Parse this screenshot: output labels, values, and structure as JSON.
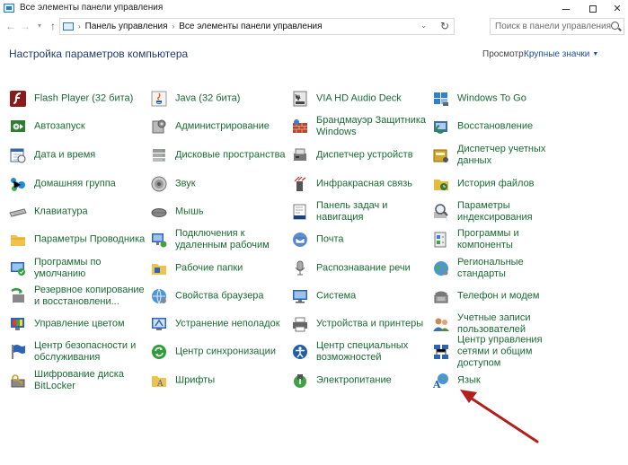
{
  "window": {
    "title": "Все элементы панели управления",
    "controls": {
      "minimize": "—",
      "maximize": "☐",
      "close": "✕"
    }
  },
  "address": {
    "crumbs": [
      "Панель управления",
      "Все элементы панели управления"
    ],
    "search_placeholder": "Поиск в панели управления"
  },
  "header": {
    "title": "Настройка параметров компьютера",
    "view_label": "Просмотр:",
    "view_value": "Крупные значки"
  },
  "colors": {
    "link": "#1a6a34",
    "heading": "#1e3c78",
    "arrow": "#b11f1f"
  },
  "items": [
    {
      "label": "Flash Player (32 бита)",
      "icon": "flash-icon"
    },
    {
      "label": "Java (32 бита)",
      "icon": "java-icon"
    },
    {
      "label": "VIA HD Audio Deck",
      "icon": "audio-deck-icon"
    },
    {
      "label": "Windows To Go",
      "icon": "windows-to-go-icon"
    },
    {
      "label": "Автозапуск",
      "icon": "autoplay-icon"
    },
    {
      "label": "Администрирование",
      "icon": "admin-tools-icon"
    },
    {
      "label": "Брандмауэр Защитника Windows",
      "icon": "firewall-icon"
    },
    {
      "label": "Восстановление",
      "icon": "recovery-icon"
    },
    {
      "label": "Дата и время",
      "icon": "calendar-clock-icon"
    },
    {
      "label": "Дисковые пространства",
      "icon": "storage-spaces-icon"
    },
    {
      "label": "Диспетчер устройств",
      "icon": "device-manager-icon"
    },
    {
      "label": "Диспетчер учетных данных",
      "icon": "credential-manager-icon"
    },
    {
      "label": "Домашняя группа",
      "icon": "homegroup-icon"
    },
    {
      "label": "Звук",
      "icon": "sound-icon"
    },
    {
      "label": "Инфракрасная связь",
      "icon": "infrared-icon"
    },
    {
      "label": "История файлов",
      "icon": "file-history-icon"
    },
    {
      "label": "Клавиатура",
      "icon": "keyboard-icon"
    },
    {
      "label": "Мышь",
      "icon": "mouse-icon"
    },
    {
      "label": "Панель задач и навигация",
      "icon": "taskbar-icon"
    },
    {
      "label": "Параметры индексирования",
      "icon": "indexing-icon"
    },
    {
      "label": "Параметры Проводника",
      "icon": "folder-options-icon"
    },
    {
      "label": "Подключения к удаленным рабочим",
      "icon": "remote-desktop-icon"
    },
    {
      "label": "Почта",
      "icon": "mail-icon"
    },
    {
      "label": "Программы и компоненты",
      "icon": "programs-icon"
    },
    {
      "label": "Программы по умолчанию",
      "icon": "default-programs-icon"
    },
    {
      "label": "Рабочие папки",
      "icon": "work-folders-icon"
    },
    {
      "label": "Распознавание речи",
      "icon": "microphone-icon"
    },
    {
      "label": "Региональные стандарты",
      "icon": "region-globe-icon"
    },
    {
      "label": "Резервное копирование и восстановлени...",
      "icon": "backup-icon"
    },
    {
      "label": "Свойства браузера",
      "icon": "internet-options-icon"
    },
    {
      "label": "Система",
      "icon": "system-icon"
    },
    {
      "label": "Телефон и модем",
      "icon": "phone-modem-icon"
    },
    {
      "label": "Управление цветом",
      "icon": "color-management-icon"
    },
    {
      "label": "Устранение неполадок",
      "icon": "troubleshooting-icon"
    },
    {
      "label": "Устройства и принтеры",
      "icon": "printer-icon"
    },
    {
      "label": "Учетные записи пользователей",
      "icon": "user-accounts-icon"
    },
    {
      "label": "Центр безопасности и обслуживания",
      "icon": "security-flag-icon"
    },
    {
      "label": "Центр синхронизации",
      "icon": "sync-center-icon"
    },
    {
      "label": "Центр специальных возможностей",
      "icon": "ease-of-access-icon"
    },
    {
      "label": "Центр управления сетями и общим доступом",
      "icon": "network-center-icon"
    },
    {
      "label": "Шифрование диска BitLocker",
      "icon": "bitlocker-icon"
    },
    {
      "label": "Шрифты",
      "icon": "fonts-icon"
    },
    {
      "label": "Электропитание",
      "icon": "power-options-icon"
    },
    {
      "label": "Язык",
      "icon": "language-icon"
    }
  ]
}
